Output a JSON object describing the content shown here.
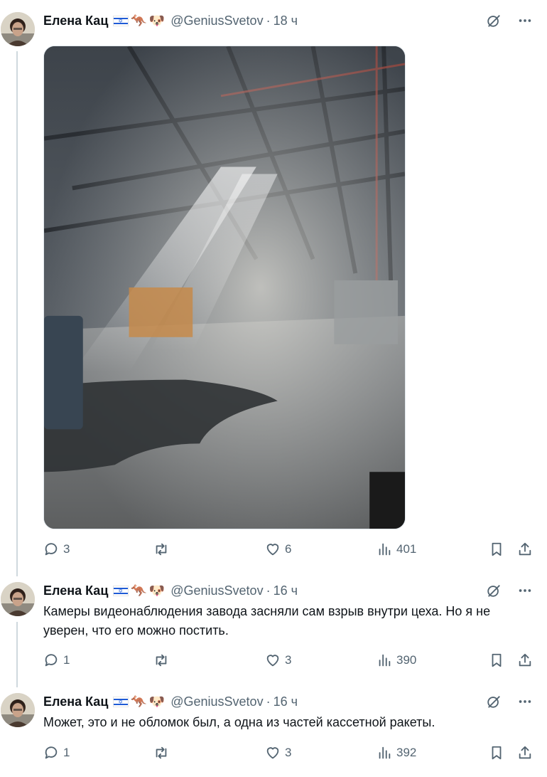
{
  "author": {
    "name": "Елена Кац",
    "flag": "israel-flag",
    "emoji": [
      "🦘",
      "🐶"
    ],
    "handle": "@GeniusSvetov",
    "separator": "·"
  },
  "tweets": [
    {
      "time": "18 ч",
      "text": "",
      "media": "photo-factory-interior-smoke",
      "replies": "3",
      "retweets": "",
      "likes": "6",
      "views": "401"
    },
    {
      "time": "16 ч",
      "text": "Камеры видеонаблюдения завода засняли сам взрыв внутри цеха. Но я не уверен, что его можно постить.",
      "replies": "1",
      "retweets": "",
      "likes": "3",
      "views": "390"
    },
    {
      "time": "16 ч",
      "text": "Может, это и не обломок был, а одна из частей кассетной ракеты.",
      "replies": "1",
      "retweets": "",
      "likes": "3",
      "views": "392"
    }
  ],
  "colors": {
    "text": "#0f1419",
    "muted": "#536471",
    "thread": "#cfd9de"
  },
  "icons": [
    "grok-icon",
    "more-icon",
    "reply-icon",
    "retweet-icon",
    "like-icon",
    "views-icon",
    "bookmark-icon",
    "share-icon"
  ]
}
